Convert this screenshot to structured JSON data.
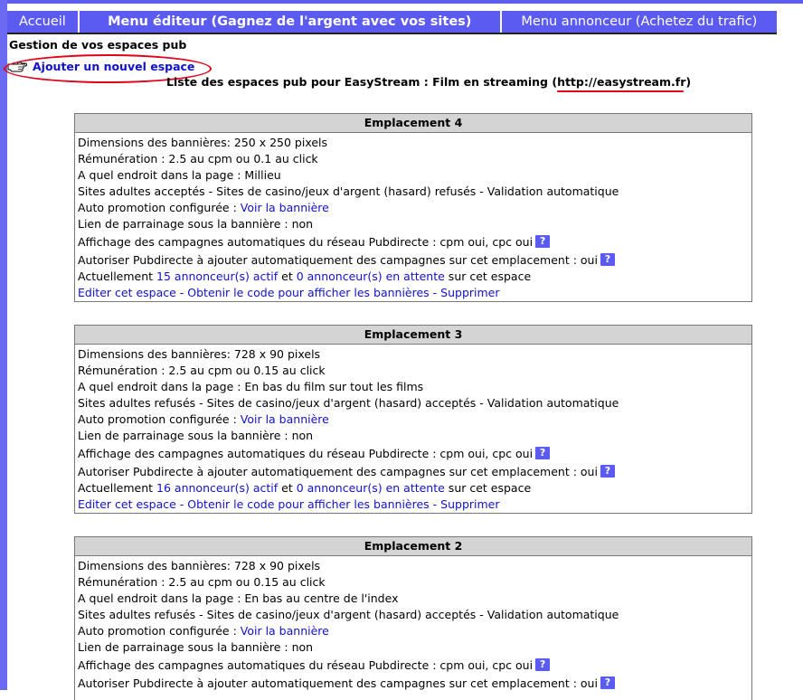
{
  "menu": {
    "home": "Accueil",
    "editor": "Menu éditeur (Gagnez de l'argent avec vos sites)",
    "advertiser": "Menu annonceur (Achetez du trafic)"
  },
  "page": {
    "section_title": "Gestion de vos espaces pub",
    "add_link": "Ajouter un nouvel espace",
    "list_title_prefix": "Liste des espaces pub pour EasyStream : Film en streaming (",
    "list_title_url": "http://easystream.fr",
    "list_title_suffix": ")"
  },
  "boxes": [
    {
      "title": "Emplacement 4",
      "dimensions": "Dimensions des bannières: 250 x 250 pixels",
      "remuneration": "Rémunération : 2.5 au cpm ou 0.1 au click",
      "location": "A quel endroit dans la page : Millieu",
      "policy": "Sites adultes acceptés - Sites de casino/jeux d'argent (hasard) refusés - Validation automatique",
      "auto_promo_label": "Auto promotion configurée : ",
      "auto_promo_link": "Voir la bannière",
      "referral": "Lien de parrainage sous la bannière : non",
      "campaigns": "Affichage des campagnes automatiques du réseau Pubdirecte : cpm oui, cpc oui",
      "authorize": "Autoriser Pubdirecte à ajouter automatiquement des campagnes sur cet emplacement : oui",
      "current_prefix": "Actuellement ",
      "active_link": "15 annonceur(s) actif",
      "current_mid": " et ",
      "pending_link": "0 annonceur(s) en attente",
      "current_suffix": " sur cet espace",
      "edit_link": "Editer cet espace",
      "code_link": "Obtenir le code pour afficher les bannières",
      "delete_link": "Supprimer"
    },
    {
      "title": "Emplacement 3",
      "dimensions": "Dimensions des bannières: 728 x 90 pixels",
      "remuneration": "Rémunération : 2.5 au cpm ou 0.15 au click",
      "location": "A quel endroit dans la page : En bas du film sur tout les films",
      "policy": "Sites adultes refusés - Sites de casino/jeux d'argent (hasard) acceptés - Validation automatique",
      "auto_promo_label": "Auto promotion configurée : ",
      "auto_promo_link": "Voir la bannière",
      "referral": "Lien de parrainage sous la bannière : non",
      "campaigns": "Affichage des campagnes automatiques du réseau Pubdirecte : cpm oui, cpc oui",
      "authorize": "Autoriser Pubdirecte à ajouter automatiquement des campagnes sur cet emplacement : oui",
      "current_prefix": "Actuellement ",
      "active_link": "16 annonceur(s) actif",
      "current_mid": " et ",
      "pending_link": "0 annonceur(s) en attente",
      "current_suffix": " sur cet espace",
      "edit_link": "Editer cet espace",
      "code_link": "Obtenir le code pour afficher les bannières",
      "delete_link": "Supprimer"
    },
    {
      "title": "Emplacement 2",
      "dimensions": "Dimensions des bannières: 728 x 90 pixels",
      "remuneration": "Rémunération : 2.5 au cpm ou 0.15 au click",
      "location": "A quel endroit dans la page : En bas au centre de l'index",
      "policy": "Sites adultes refusés - Sites de casino/jeux d'argent (hasard) acceptés - Validation automatique",
      "auto_promo_label": "Auto promotion configurée : ",
      "auto_promo_link": "Voir la bannière",
      "referral": "Lien de parrainage sous la bannière : non",
      "campaigns": "Affichage des campagnes automatiques du réseau Pubdirecte : cpm oui, cpc oui",
      "authorize": "Autoriser Pubdirecte à ajouter automatiquement des campagnes sur cet emplacement : oui"
    }
  ],
  "help_icon_glyph": "?",
  "colors": {
    "menu_bg": "#5b5bf2",
    "link": "#1111cc",
    "annotation": "#e0001a",
    "box_header": "#d4d4d4"
  }
}
